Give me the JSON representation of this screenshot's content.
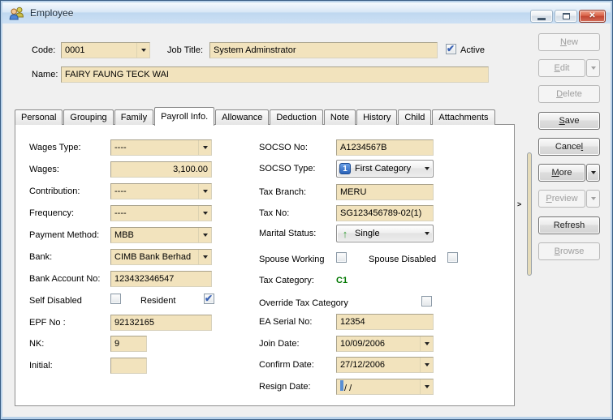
{
  "window": {
    "title": "Employee"
  },
  "icons": {
    "close": "✕",
    "check": "✔",
    "splitter_arrow": ">"
  },
  "header": {
    "code_label": "Code:",
    "code_value": "0001",
    "job_title_label": "Job Title:",
    "job_title_value": "System Adminstrator",
    "active_label": "Active",
    "active_checked": true,
    "name_label": "Name:",
    "name_value": "FAIRY FAUNG TECK WAI"
  },
  "tabs": {
    "items": [
      "Personal",
      "Grouping",
      "Family",
      "Payroll Info.",
      "Allowance",
      "Deduction",
      "Note",
      "History",
      "Child",
      "Attachments"
    ],
    "active": "Payroll Info."
  },
  "payroll": {
    "wages_type": {
      "label": "Wages Type:",
      "value": "----"
    },
    "wages": {
      "label": "Wages:",
      "value": "3,100.00"
    },
    "contribution": {
      "label": "Contribution:",
      "value": "----"
    },
    "frequency": {
      "label": "Frequency:",
      "value": "----"
    },
    "payment_method": {
      "label": "Payment Method:",
      "value": "MBB"
    },
    "bank": {
      "label": "Bank:",
      "value": "CIMB Bank Berhad"
    },
    "bank_account_no": {
      "label": "Bank Account No:",
      "value": "123432346547"
    },
    "self_disabled": {
      "label": "Self Disabled",
      "checked": false
    },
    "resident": {
      "label": "Resident",
      "checked": true
    },
    "epf_no": {
      "label": "EPF No :",
      "value": "92132165"
    },
    "nk": {
      "label": "NK:",
      "value": "9"
    },
    "initial": {
      "label": "Initial:",
      "value": ""
    },
    "socso_no": {
      "label": "SOCSO No:",
      "value": "A1234567B"
    },
    "socso_type": {
      "label": "SOCSO Type:",
      "value": "First Category",
      "icon": "1"
    },
    "tax_branch": {
      "label": "Tax Branch:",
      "value": "MERU"
    },
    "tax_no": {
      "label": "Tax No:",
      "value": "SG123456789-02(1)"
    },
    "marital_status": {
      "label": "Marital Status:",
      "value": "Single",
      "icon": "↑"
    },
    "spouse_working": {
      "label": "Spouse Working",
      "checked": false
    },
    "spouse_disabled": {
      "label": "Spouse Disabled",
      "checked": false
    },
    "tax_category": {
      "label": "Tax Category:",
      "value": "C1"
    },
    "override_tax_category": {
      "label": "Override Tax Category",
      "checked": false
    },
    "ea_serial_no": {
      "label": "EA Serial No:",
      "value": "12354"
    },
    "join_date": {
      "label": "Join Date:",
      "value": "10/09/2006"
    },
    "confirm_date": {
      "label": "Confirm Date:",
      "value": "27/12/2006"
    },
    "resign_date": {
      "label": "Resign Date:",
      "value": "/  /"
    }
  },
  "buttons": {
    "new": "&New",
    "edit": "&Edit",
    "delete": "&Delete",
    "save": "&Save",
    "cancel": "Cance&l",
    "more": "&More",
    "preview": "&Preview",
    "refresh": "Refresh",
    "browse": "&Browse"
  }
}
